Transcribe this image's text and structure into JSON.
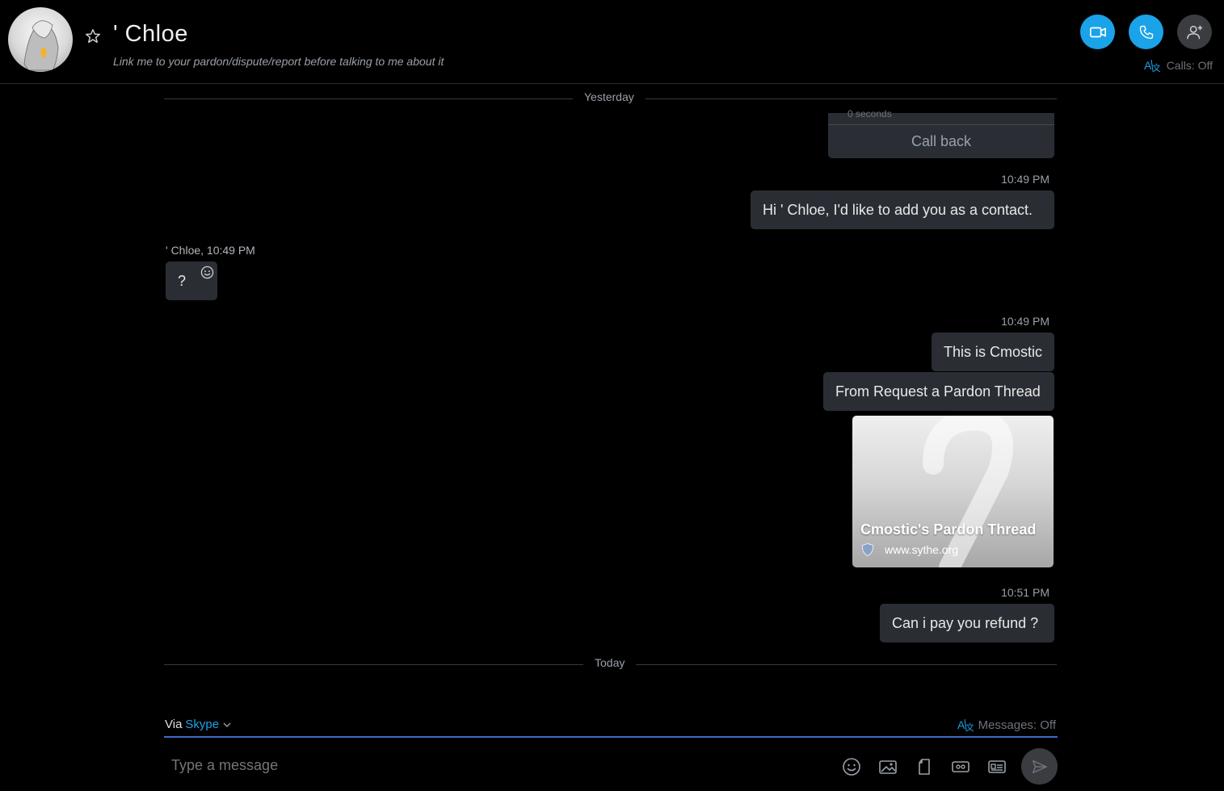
{
  "header": {
    "contact_name": "' Chloe",
    "mood_message": "Link me to your pardon/dispute/report before talking to me about it",
    "calls_status": "Calls: Off"
  },
  "dividers": {
    "yesterday": "Yesterday",
    "today": "Today"
  },
  "call_card": {
    "duration": "0 seconds",
    "action": "Call back"
  },
  "messages": {
    "ts1": "10:49 PM",
    "msg1": "Hi ' Chloe, I'd like to add you as a contact.",
    "incoming_sender": "' Chloe,",
    "incoming_time": "10:49 PM",
    "incoming_text": "?",
    "ts2": "10:49 PM",
    "msg2": "This is Cmostic",
    "msg3": "From Request a Pardon Thread",
    "link_title": "Cmostic's Pardon Thread",
    "link_url": "www.sythe.org",
    "ts3": "10:51 PM",
    "msg4": "Can i pay you refund ?"
  },
  "compose": {
    "via_label": "Via",
    "via_service": "Skype",
    "messages_status": "Messages: Off",
    "placeholder": "Type a message"
  },
  "colors": {
    "accent": "#1aa3e8",
    "bubble": "#2a2e34",
    "background": "#000000"
  }
}
